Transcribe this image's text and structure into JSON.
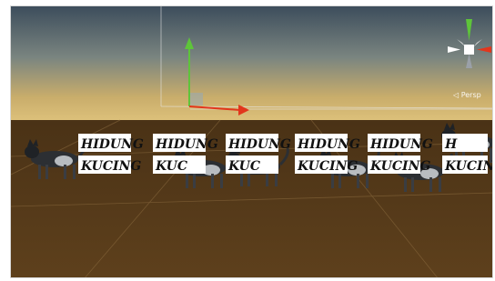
{
  "scene": {
    "camera_projection_label": "◁ Persp",
    "signs": [
      {
        "top_word": "HIDUNG",
        "bottom_word": "KUCING"
      },
      {
        "top_word": "HIDUNG",
        "bottom_word": "KUC"
      },
      {
        "top_word": "HIDUNG",
        "bottom_word": "KUC"
      },
      {
        "top_word": "HIDUNG",
        "bottom_word": "KUCING"
      },
      {
        "top_word": "HIDUNG",
        "bottom_word": "KUCING"
      },
      {
        "top_word": "H",
        "bottom_word": "KUCING"
      }
    ]
  },
  "colors": {
    "sky_top": "#3f4f5e",
    "sky_horizon": "#d6b56a",
    "ground": "#5c3f1c",
    "axis_x": "#e2361c",
    "axis_y": "#5ec43a",
    "axis_z": "#3f6fe0"
  },
  "icons": {
    "scene_gizmo": "scene-orientation-gizmo-icon",
    "move_handle": "move-tool-handle-icon",
    "cat_model": "cat-3d-model-icon"
  }
}
